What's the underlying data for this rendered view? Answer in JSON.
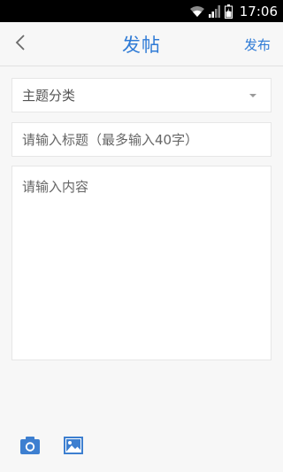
{
  "status_bar": {
    "time": "17:06",
    "icons": [
      "wifi-icon",
      "signal-icon",
      "battery-charging-icon"
    ]
  },
  "nav": {
    "back_icon": "chevron-left-icon",
    "title": "发帖",
    "publish_label": "发布"
  },
  "form": {
    "category_label": "主题分类",
    "category_icon": "dropdown-arrow-icon",
    "title_placeholder": "请输入标题（最多输入40字）",
    "content_placeholder": "请输入内容"
  },
  "toolbar": {
    "camera_icon": "camera-icon",
    "image_icon": "image-icon"
  },
  "colors": {
    "accent": "#2f7bd6",
    "background": "#f7f7f7",
    "field_bg": "#ffffff"
  }
}
